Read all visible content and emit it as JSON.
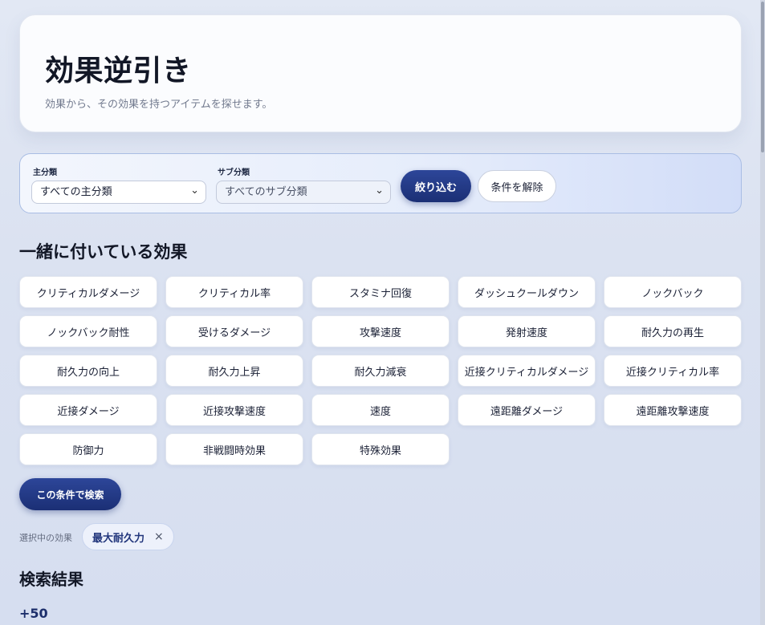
{
  "header": {
    "title": "効果逆引き",
    "subtitle": "効果から、その効果を持つアイテムを探せます。"
  },
  "filters": {
    "main": {
      "label": "主分類",
      "value": "すべての主分類"
    },
    "sub": {
      "label": "サブ分類",
      "value": "すべてのサブ分類"
    },
    "apply_label": "絞り込む",
    "clear_label": "条件を解除"
  },
  "effects": {
    "title": "一緒に付いている効果",
    "items": [
      "クリティカルダメージ",
      "クリティカル率",
      "スタミナ回復",
      "ダッシュクールダウン",
      "ノックバック",
      "ノックバック耐性",
      "受けるダメージ",
      "攻撃速度",
      "発射速度",
      "耐久力の再生",
      "耐久力の向上",
      "耐久力上昇",
      "耐久力減衰",
      "近接クリティカルダメージ",
      "近接クリティカル率",
      "近接ダメージ",
      "近接攻撃速度",
      "速度",
      "遠距離ダメージ",
      "遠距離攻撃速度",
      "防御力",
      "非戦闘時効果",
      "特殊効果"
    ],
    "search_label": "この条件で検索"
  },
  "selected": {
    "label": "選択中の効果",
    "effect": "最大耐久力",
    "remove_symbol": "×"
  },
  "results": {
    "title": "検索結果",
    "first_value": "+50"
  }
}
